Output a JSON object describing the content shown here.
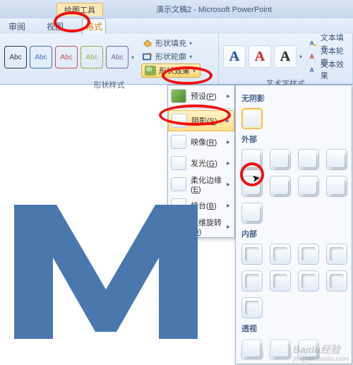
{
  "window": {
    "drawing_tools_tab": "绘图工具",
    "title": "演示文稿2 - Microsoft PowerPoint"
  },
  "tabs": {
    "review": "审阅",
    "view": "视图",
    "format": "格式"
  },
  "ribbon": {
    "shape_styles": {
      "label": "形状样式",
      "items": [
        {
          "text": "Abc",
          "border": "#333333",
          "color": "#333333"
        },
        {
          "text": "Abc",
          "border": "#3b6fb5",
          "color": "#3b6fb5"
        },
        {
          "text": "Abc",
          "border": "#c2514a",
          "color": "#c2514a"
        },
        {
          "text": "Abc",
          "border": "#8fae4a",
          "color": "#8fae4a"
        },
        {
          "text": "Abc",
          "border": "#7b63a1",
          "color": "#7b63a1"
        }
      ],
      "fill": "形状填充",
      "outline": "形状轮廓",
      "effects": "形状效果"
    },
    "wordart": {
      "label": "艺术字样式",
      "items": [
        {
          "letter": "A",
          "stroke": "#2b5aa0"
        },
        {
          "letter": "A",
          "stroke": "#c73c33"
        },
        {
          "letter": "A",
          "stroke": "#333333"
        }
      ],
      "textfill": "文本填充",
      "textoutline": "文本轮廓",
      "texteffects": "文本效果"
    }
  },
  "effects_menu": {
    "preset": {
      "label": "预设",
      "key": "P"
    },
    "shadow": {
      "label": "阴影",
      "key": "S"
    },
    "reflect": {
      "label": "映像",
      "key": "R"
    },
    "glow": {
      "label": "发光",
      "key": "G"
    },
    "soft": {
      "label": "柔化边缘",
      "key": "E"
    },
    "bevel": {
      "label": "棱台",
      "key": "B"
    },
    "rotate3d": {
      "label": "三维旋转",
      "key": "D"
    }
  },
  "shadow_gallery": {
    "none": "无阴影",
    "outer": "外部",
    "inner": "内部",
    "perspective": "透视"
  },
  "watermark": {
    "brand": "Baidu经验",
    "url": "jingyan.baidu.com"
  }
}
